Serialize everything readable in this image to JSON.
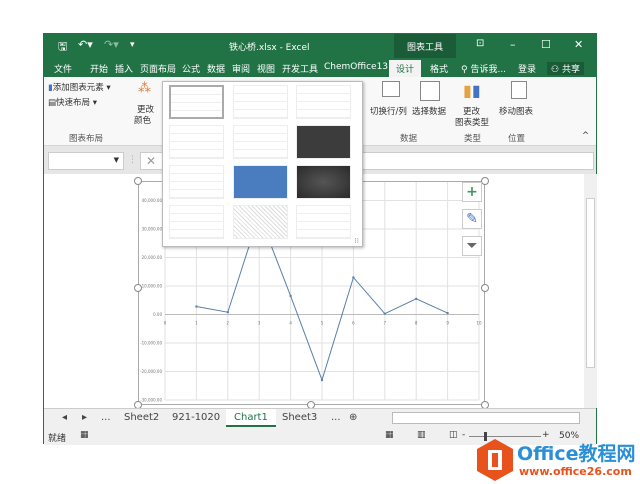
{
  "window": {
    "title": "铁心桥.xlsx - Excel",
    "context_tab": "图表工具"
  },
  "tabs": [
    "文件",
    "开始",
    "插入",
    "页面布局",
    "公式",
    "数据",
    "审阅",
    "视图",
    "开发工具",
    "ChemOffice13",
    "设计",
    "格式"
  ],
  "tell_me": "告诉我...",
  "login": "登录",
  "share": "共享",
  "ribbon": {
    "add_element": "添加图表元素",
    "quick_layout": "快速布局",
    "change_color_1": "更改",
    "change_color_2": "颜色",
    "group_layout": "图表布局",
    "switch_rowcol": "切换行/列",
    "select_data": "选择数据",
    "group_data": "数据",
    "change_type_1": "更改",
    "change_type_2": "图表类型",
    "group_type": "类型",
    "move_chart": "移动图表",
    "group_location": "位置"
  },
  "formula_bar": {
    "name_box": "",
    "cancel": "✕"
  },
  "sheet_tabs": [
    "...",
    "Sheet2",
    "921-1020",
    "Chart1",
    "Sheet3",
    "..."
  ],
  "active_sheet": "Chart1",
  "status": {
    "ready": "就绪",
    "zoom": "50%"
  },
  "watermark": {
    "brand": "Office教程网",
    "url": "www.office26.com"
  },
  "chart_data": {
    "type": "line",
    "x": [
      1,
      2,
      3,
      4,
      5,
      6,
      7,
      8,
      9
    ],
    "values": [
      2800,
      800,
      35000,
      6500,
      -23000,
      13000,
      300,
      5500,
      500
    ],
    "xlim": [
      0,
      10
    ],
    "ylim": [
      -30000,
      40000
    ],
    "xticks": [
      "0",
      "1",
      "2",
      "3",
      "4",
      "5",
      "6",
      "7",
      "8",
      "9",
      "10"
    ],
    "yticks": [
      "40,000.00",
      "30,000.00",
      "20,000.00",
      "10,000.00",
      "0.00",
      "-10,000.00",
      "-20,000.00",
      "-30,000.00"
    ],
    "grid": true,
    "line_color": "#5a7fa8"
  }
}
